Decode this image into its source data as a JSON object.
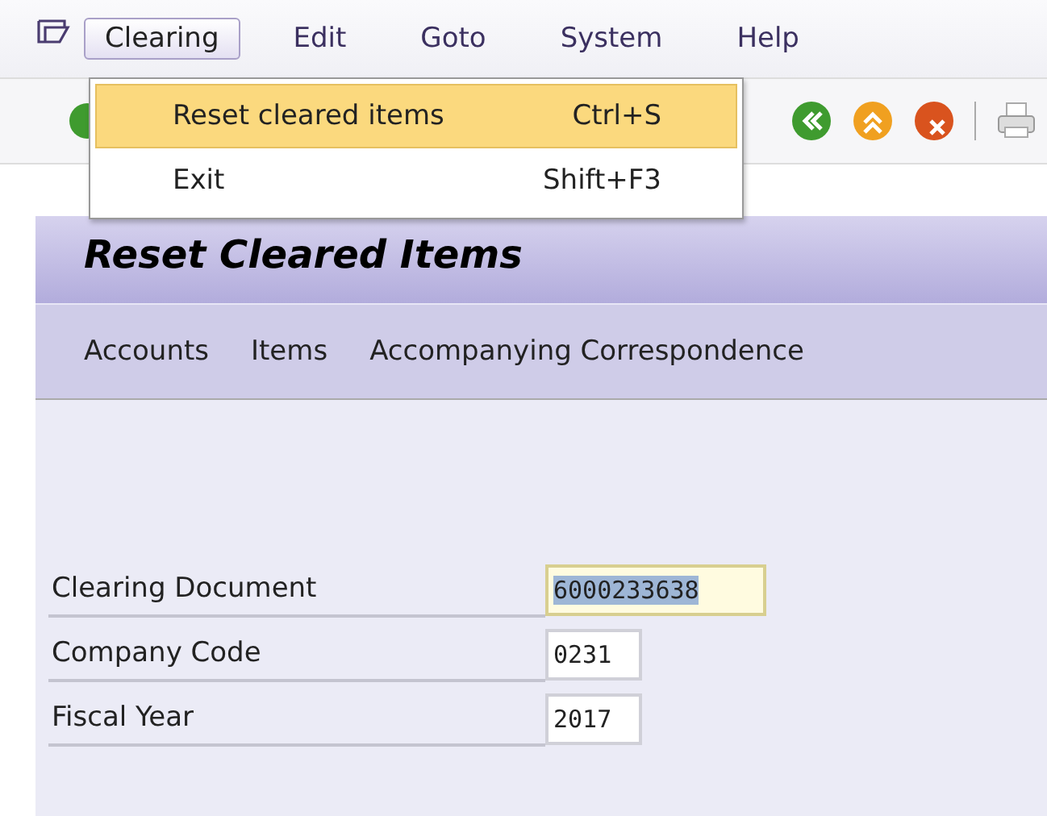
{
  "menu_bar": [
    {
      "label": "Clearing",
      "selected": true
    },
    {
      "label": "Edit",
      "selected": false
    },
    {
      "label": "Goto",
      "selected": false
    },
    {
      "label": "System",
      "selected": false
    },
    {
      "label": "Help",
      "selected": false
    }
  ],
  "dropdown_menu": [
    {
      "label": "Reset cleared items",
      "shortcut": "Ctrl+S",
      "selected": true
    },
    {
      "label": "Exit",
      "shortcut": "Shift+F3",
      "selected": false
    }
  ],
  "screen_title": "Reset Cleared Items",
  "application_toolbar": [
    "Accounts",
    "Items",
    "Accompanying Correspondence"
  ],
  "fields": [
    {
      "label": "Clearing Document",
      "value": "6000233638",
      "selected": true,
      "kind": "wide"
    },
    {
      "label": "Company Code",
      "value": "0231",
      "selected": false,
      "kind": "short"
    },
    {
      "label": "Fiscal Year",
      "value": "2017",
      "selected": false,
      "kind": "short"
    }
  ]
}
